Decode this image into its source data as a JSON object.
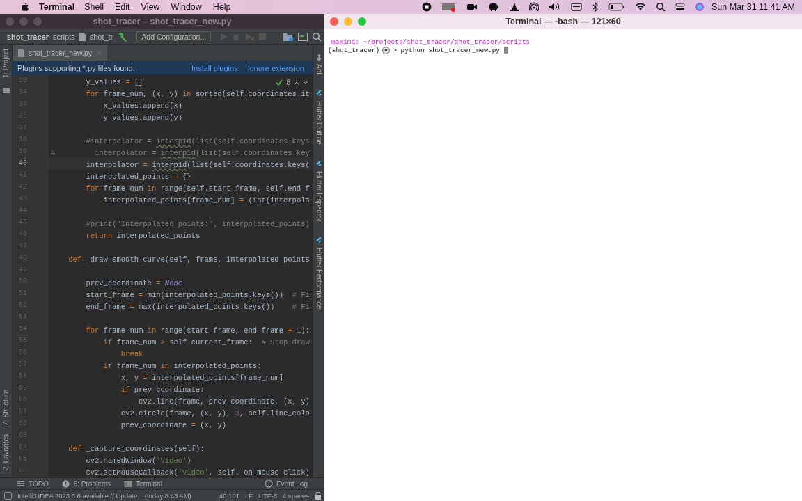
{
  "menu_bar": {
    "app": "Terminal",
    "items": [
      "Shell",
      "Edit",
      "View",
      "Window",
      "Help"
    ],
    "clock": "Sun Mar 31  11:41 AM"
  },
  "ide": {
    "title": "shot_tracer – shot_tracer_new.py",
    "breadcrumbs": [
      "shot_tracer",
      "scripts",
      "shot_tr"
    ],
    "run_config": "Add Configuration...",
    "tabs": [
      {
        "label": "shot_tracer_new.py",
        "selected": true
      }
    ],
    "banner": {
      "message": "Plugins supporting *.py files found.",
      "actions": [
        "Install plugins",
        "Ignore extension"
      ]
    },
    "left_tools": [
      "1: Project",
      "7: Structure",
      "2: Favorites"
    ],
    "right_tools": [
      "Ant",
      "Flutter Outline",
      "Flutter Inspector",
      "Flutter Performance"
    ],
    "inspection_count": "8",
    "lines": [
      {
        "number": "33",
        "current": false,
        "tokens": [
          {
            "kind": "plain",
            "text": "        y_values "
          },
          {
            "kind": "op",
            "text": "="
          },
          {
            "kind": "plain",
            "text": " []"
          }
        ]
      },
      {
        "number": "34",
        "current": false,
        "tokens": [
          {
            "kind": "keyword",
            "text": "        for"
          },
          {
            "kind": "plain",
            "text": " frame_num, (x, y) "
          },
          {
            "kind": "keyword",
            "text": "in"
          },
          {
            "kind": "plain",
            "text": " sorted(self.coordinates.it"
          }
        ]
      },
      {
        "number": "35",
        "current": false,
        "tokens": [
          {
            "kind": "plain",
            "text": "            x_values.append(x)"
          }
        ]
      },
      {
        "number": "36",
        "current": false,
        "tokens": [
          {
            "kind": "plain",
            "text": "            y_values.append(y)"
          }
        ]
      },
      {
        "number": "37",
        "current": false
      },
      {
        "number": "38",
        "current": false,
        "tokens": [
          {
            "kind": "comment",
            "text": "        #interpolator = "
          },
          {
            "kind": "flagged-comment",
            "text": "interp1d"
          },
          {
            "kind": "comment",
            "text": "(list(self.coordinates.keys"
          }
        ]
      },
      {
        "number": "39",
        "current": false,
        "tokens": [
          {
            "kind": "comment",
            "text": "#         interpolator = "
          },
          {
            "kind": "flagged-comment",
            "text": "interp1d"
          },
          {
            "kind": "comment",
            "text": "(list(self.coordinates.key"
          }
        ]
      },
      {
        "number": "40",
        "current": true,
        "tokens": [
          {
            "kind": "plain",
            "text": "        interpolator "
          },
          {
            "kind": "op",
            "text": "= "
          },
          {
            "kind": "flagged",
            "text": "interp1d"
          },
          {
            "kind": "plain",
            "text": "(list(self.coordinates.keys("
          }
        ]
      },
      {
        "number": "41",
        "current": false,
        "tokens": [
          {
            "kind": "plain",
            "text": "        interpolated_points "
          },
          {
            "kind": "op",
            "text": "="
          },
          {
            "kind": "plain",
            "text": " {}"
          }
        ]
      },
      {
        "number": "42",
        "current": false,
        "tokens": [
          {
            "kind": "keyword",
            "text": "        for"
          },
          {
            "kind": "plain",
            "text": " frame_num "
          },
          {
            "kind": "keyword",
            "text": "in"
          },
          {
            "kind": "plain",
            "text": " range(self.start_frame, self.end_f"
          }
        ]
      },
      {
        "number": "43",
        "current": false,
        "tokens": [
          {
            "kind": "plain",
            "text": "            interpolated_points[frame_num] "
          },
          {
            "kind": "op",
            "text": "="
          },
          {
            "kind": "plain",
            "text": " (int(interpola"
          }
        ]
      },
      {
        "number": "44",
        "current": false
      },
      {
        "number": "45",
        "current": false,
        "tokens": [
          {
            "kind": "comment",
            "text": "        #print(\"Interpolated points:\", interpolated_points)"
          }
        ]
      },
      {
        "number": "46",
        "current": false,
        "tokens": [
          {
            "kind": "keyword",
            "text": "        return"
          },
          {
            "kind": "plain",
            "text": " interpolated_points"
          }
        ]
      },
      {
        "number": "47",
        "current": false
      },
      {
        "number": "48",
        "current": false,
        "tokens": [
          {
            "kind": "keyword",
            "text": "    def"
          },
          {
            "kind": "plain",
            "text": " _draw_smooth_curve(self, frame, interpolated_points"
          }
        ]
      },
      {
        "number": "49",
        "current": false
      },
      {
        "number": "50",
        "current": false,
        "tokens": [
          {
            "kind": "plain",
            "text": "        prev_coordinate "
          },
          {
            "kind": "op",
            "text": "= "
          },
          {
            "kind": "constant",
            "text": "None"
          }
        ]
      },
      {
        "number": "51",
        "current": false,
        "tokens": [
          {
            "kind": "plain",
            "text": "        start_frame "
          },
          {
            "kind": "op",
            "text": "="
          },
          {
            "kind": "plain",
            "text": " min(interpolated_points.keys())  "
          },
          {
            "kind": "comment",
            "text": "# Fi"
          }
        ]
      },
      {
        "number": "52",
        "current": false,
        "tokens": [
          {
            "kind": "plain",
            "text": "        end_frame "
          },
          {
            "kind": "op",
            "text": "="
          },
          {
            "kind": "plain",
            "text": " max(interpolated_points.keys())    "
          },
          {
            "kind": "comment",
            "text": "# Fi"
          }
        ]
      },
      {
        "number": "53",
        "current": false
      },
      {
        "number": "54",
        "current": false,
        "tokens": [
          {
            "kind": "keyword",
            "text": "        for"
          },
          {
            "kind": "plain",
            "text": " frame_num "
          },
          {
            "kind": "keyword",
            "text": "in"
          },
          {
            "kind": "plain",
            "text": " range(start_frame, end_frame "
          },
          {
            "kind": "op",
            "text": "+ "
          },
          {
            "kind": "number",
            "text": "1"
          },
          {
            "kind": "plain",
            "text": "):"
          }
        ]
      },
      {
        "number": "55",
        "current": false,
        "tokens": [
          {
            "kind": "keyword",
            "text": "            if"
          },
          {
            "kind": "plain",
            "text": " frame_num "
          },
          {
            "kind": "op",
            "text": ">"
          },
          {
            "kind": "plain",
            "text": " self.current_frame:  "
          },
          {
            "kind": "comment",
            "text": "# Stop draw"
          }
        ]
      },
      {
        "number": "56",
        "current": false,
        "tokens": [
          {
            "kind": "keyword",
            "text": "                break"
          }
        ]
      },
      {
        "number": "57",
        "current": false,
        "tokens": [
          {
            "kind": "keyword",
            "text": "            if"
          },
          {
            "kind": "plain",
            "text": " frame_num "
          },
          {
            "kind": "keyword",
            "text": "in"
          },
          {
            "kind": "plain",
            "text": " interpolated_points:"
          }
        ]
      },
      {
        "number": "58",
        "current": false,
        "tokens": [
          {
            "kind": "plain",
            "text": "                x, y "
          },
          {
            "kind": "op",
            "text": "="
          },
          {
            "kind": "plain",
            "text": " interpolated_points[frame_num]"
          }
        ]
      },
      {
        "number": "59",
        "current": false,
        "tokens": [
          {
            "kind": "keyword",
            "text": "                if"
          },
          {
            "kind": "plain",
            "text": " prev_coordinate:"
          }
        ]
      },
      {
        "number": "60",
        "current": false,
        "tokens": [
          {
            "kind": "plain",
            "text": "                    cv2.line(frame, prev_coordinate, (x, y)"
          }
        ]
      },
      {
        "number": "61",
        "current": false,
        "tokens": [
          {
            "kind": "plain",
            "text": "                cv2.circle(frame, (x, y), "
          },
          {
            "kind": "number",
            "text": "3"
          },
          {
            "kind": "plain",
            "text": ", self.line_colo"
          }
        ]
      },
      {
        "number": "62",
        "current": false,
        "tokens": [
          {
            "kind": "plain",
            "text": "                prev_coordinate "
          },
          {
            "kind": "op",
            "text": "="
          },
          {
            "kind": "plain",
            "text": " (x, y)"
          }
        ]
      },
      {
        "number": "63",
        "current": false
      },
      {
        "number": "64",
        "current": false,
        "tokens": [
          {
            "kind": "keyword",
            "text": "    def"
          },
          {
            "kind": "plain",
            "text": " _capture_coordinates(self):"
          }
        ]
      },
      {
        "number": "65",
        "current": false,
        "tokens": [
          {
            "kind": "plain",
            "text": "        cv2.namedWindow("
          },
          {
            "kind": "string",
            "text": "'Video'"
          },
          {
            "kind": "plain",
            "text": ")"
          }
        ]
      },
      {
        "number": "66",
        "current": false,
        "tokens": [
          {
            "kind": "plain",
            "text": "        cv2.setMouseCallback("
          },
          {
            "kind": "string",
            "text": "'Video'"
          },
          {
            "kind": "plain",
            "text": ", self._on_mouse_click)"
          }
        ]
      }
    ],
    "tool_tabs": [
      "TODO",
      "6: Problems",
      "Terminal"
    ],
    "event_log": "Event Log",
    "status": {
      "message": "IntelliJ IDEA 2023.3.6 available // Update... (today 8:43 AM)",
      "position": "40:101",
      "line_ending": "LF",
      "encoding": "UTF-8",
      "indent": "4 spaces"
    }
  },
  "terminal": {
    "title": "Terminal — -bash — 121×60",
    "prompt_path": "maxima: ~/projects/shot_tracer/shot_tracer/scripts",
    "env": "(shot_tracer)",
    "command": "> python shot_tracer_new.py"
  }
}
